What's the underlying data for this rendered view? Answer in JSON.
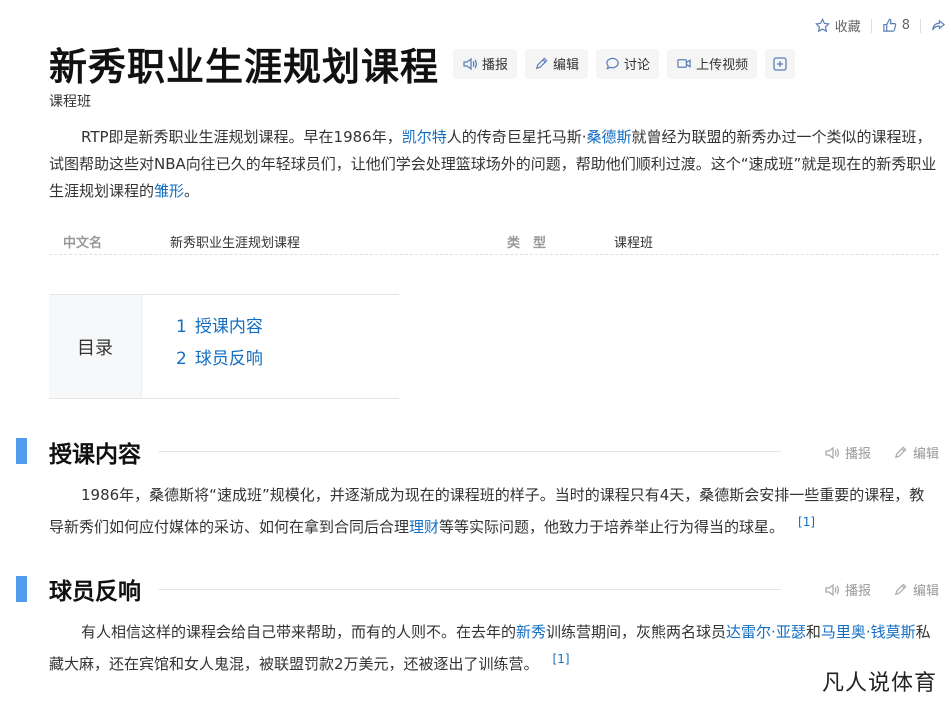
{
  "top_actions": {
    "favorite_label": "收藏",
    "like_count": "8",
    "share_label": ""
  },
  "title": "新秀职业生涯规划课程",
  "title_buttons": {
    "play": "播报",
    "edit": "编辑",
    "discuss": "讨论",
    "upload": "上传视频"
  },
  "subtitle": "课程班",
  "summary": {
    "t1": "RTP即是新秀职业生涯规划课程。早在1986年，",
    "link1": "凯尔特",
    "t2": "人的传奇巨星托马斯·",
    "link2": "桑德斯",
    "t3": "就曾经为联盟的新秀办过一个类似的课程班，试图帮助这些对NBA向往已久的年轻球员们，让他们学会处理篮球场外的问题，帮助他们顺利过渡。这个“速成班”就是现在的新秀职业生涯规划课程的",
    "link3": "雏形",
    "t4": "。"
  },
  "info": {
    "k1": "中文名",
    "v1": "新秀职业生涯规划课程",
    "k2": "类　型",
    "v2": "课程班"
  },
  "catalog": {
    "label": "目录",
    "items": [
      {
        "num": "1",
        "label": "授课内容"
      },
      {
        "num": "2",
        "label": "球员反响"
      }
    ]
  },
  "section_actions": {
    "play": "播报",
    "edit": "编辑"
  },
  "sections": [
    {
      "title": "授课内容",
      "t1": "1986年，桑德斯将“速成班”规模化，并逐渐成为现在的课程班的样子。当时的课程只有4天，桑德斯会安排一些重要的课程，教导新秀们如何应付媒体的采访、如何在拿到合同后合理",
      "link1": "理财",
      "t2": "等等实际问题，他致力于培养举止行为得当的球星。",
      "ref": "[1]"
    },
    {
      "title": "球员反响",
      "t1": "有人相信这样的课程会给自己带来帮助，而有的人则不。在去年的",
      "link1": "新秀",
      "t2": "训练营期间，灰熊两名球员",
      "link2": "达雷尔·亚瑟",
      "t3": "和",
      "link3": "马里奥·钱莫斯",
      "t4": "私藏大麻，还在宾馆和女人鬼混，被联盟罚款2万美元，还被逐出了训练营。",
      "ref": "[1]"
    }
  ],
  "watermark": "凡人说体育",
  "colors": {
    "link": "#136ec2",
    "accent_bar": "#4f9cee",
    "icon": "#5b7fb8"
  }
}
